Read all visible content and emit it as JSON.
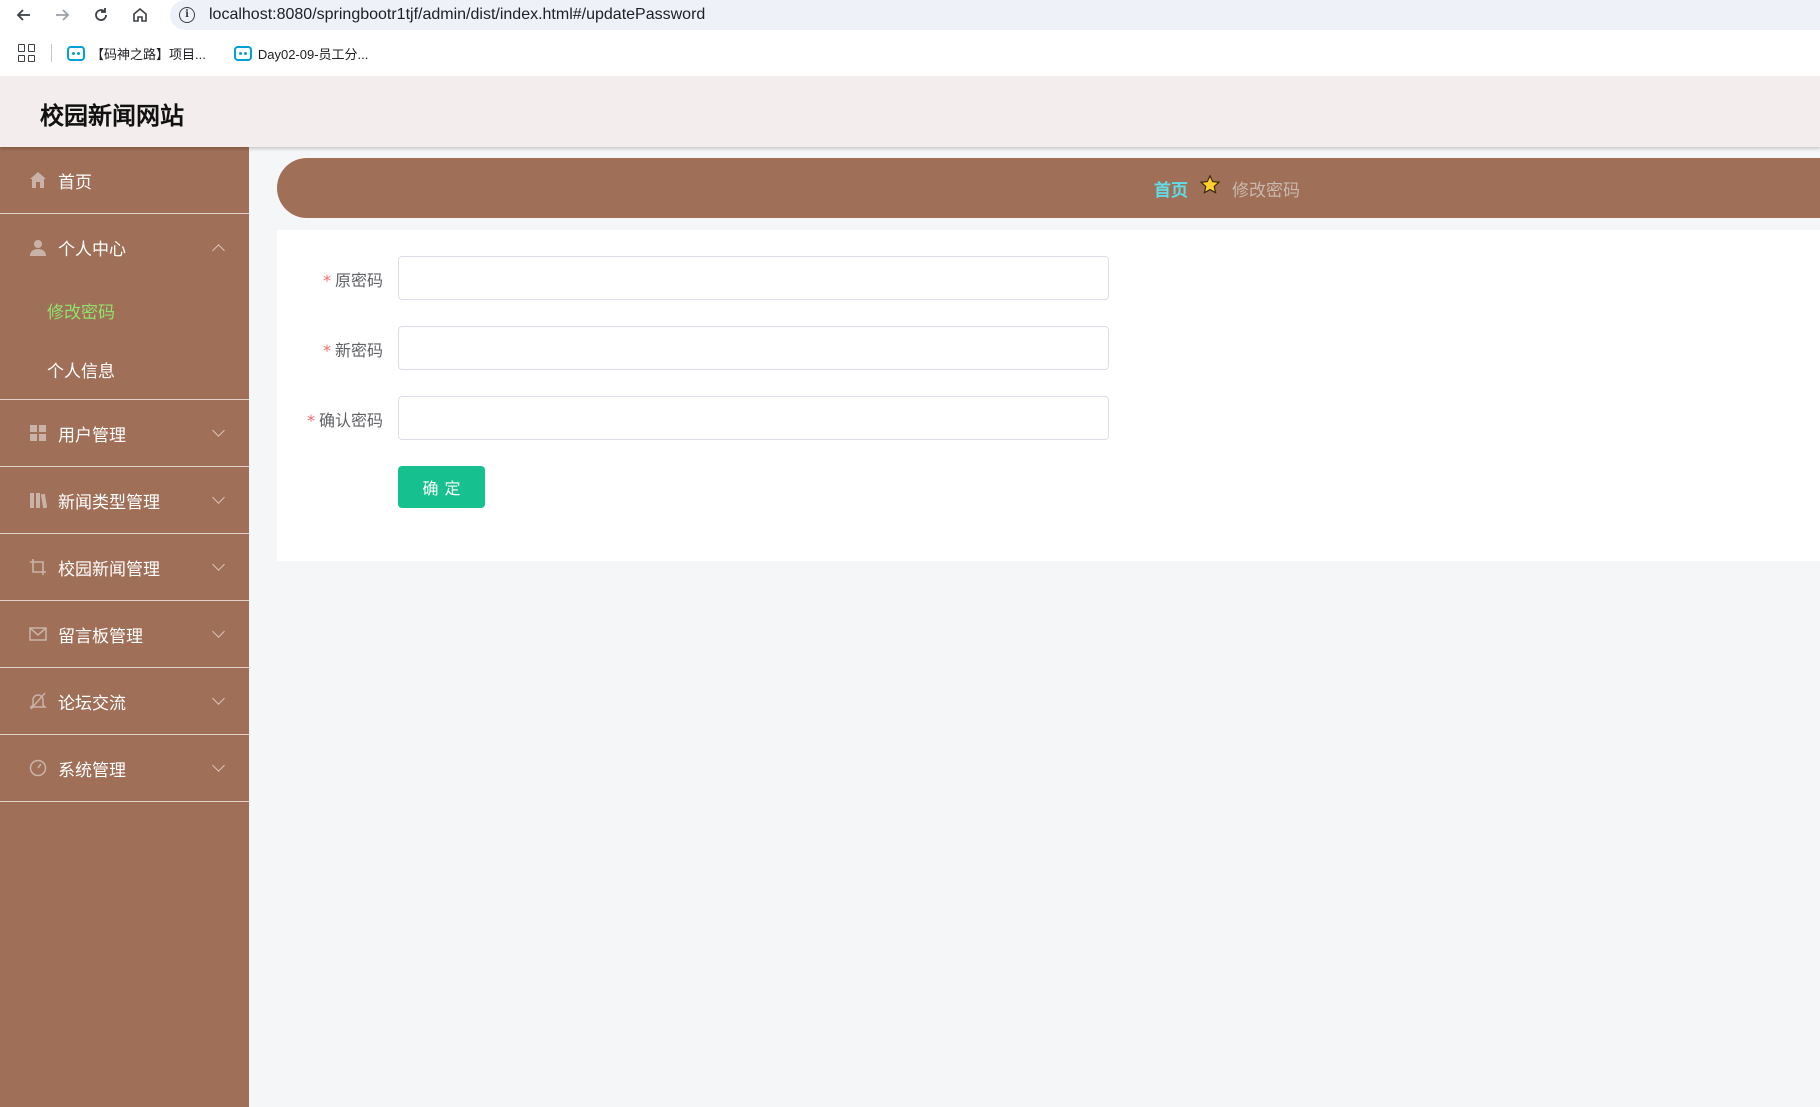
{
  "browser": {
    "url": "localhost:8080/springbootr1tjf/admin/dist/index.html#/updatePassword",
    "bookmarks": [
      {
        "label": "【码神之路】项目..."
      },
      {
        "label": "Day02-09-员工分..."
      }
    ]
  },
  "header": {
    "site_title": "校园新闻网站"
  },
  "sidebar": {
    "items": [
      {
        "label": "首页",
        "icon": "home-icon"
      },
      {
        "label": "个人中心",
        "icon": "user-icon",
        "expanded": true,
        "children": [
          {
            "label": "修改密码",
            "active": true
          },
          {
            "label": "个人信息"
          }
        ]
      },
      {
        "label": "用户管理",
        "icon": "grid-icon"
      },
      {
        "label": "新闻类型管理",
        "icon": "books-icon"
      },
      {
        "label": "校园新闻管理",
        "icon": "crop-icon"
      },
      {
        "label": "留言板管理",
        "icon": "mail-icon"
      },
      {
        "label": "论坛交流",
        "icon": "bell-off-icon"
      },
      {
        "label": "系统管理",
        "icon": "gauge-icon"
      }
    ]
  },
  "breadcrumb": {
    "home": "首页",
    "current": "修改密码",
    "home_color": "#5fdde8"
  },
  "form": {
    "fields": [
      {
        "label": "原密码",
        "required": true,
        "value": ""
      },
      {
        "label": "新密码",
        "required": true,
        "value": ""
      },
      {
        "label": "确认密码",
        "required": true,
        "value": ""
      }
    ],
    "submit_label": "确定",
    "required_mark": "*"
  },
  "colors": {
    "sidebar_bg": "#a06f57",
    "header_bg": "#f3eded",
    "active_menu": "#8fe36a",
    "submit_bg": "#16c18f"
  }
}
